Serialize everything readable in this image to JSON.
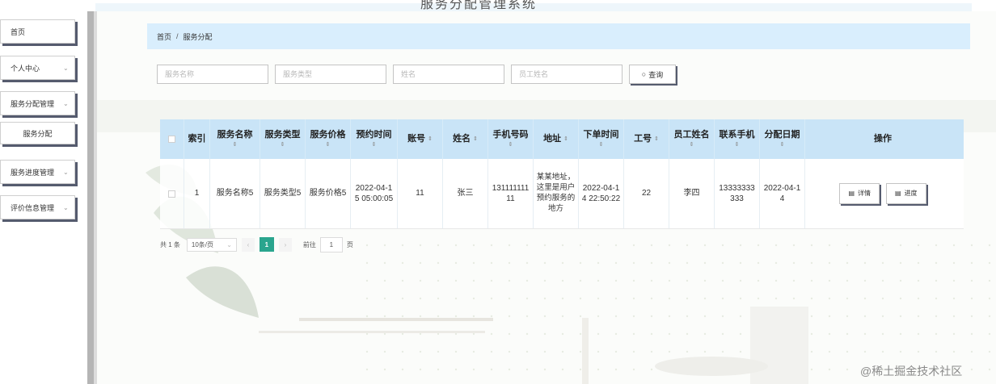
{
  "header": {
    "title": "服务分配管理系统"
  },
  "sidebar": {
    "items": [
      {
        "label": "首页",
        "chevron": ""
      },
      {
        "label": "个人中心",
        "chevron": "⌄"
      },
      {
        "label": "服务分配管理",
        "chevron": "⌄"
      },
      {
        "label": "服务分配",
        "chevron": ""
      },
      {
        "label": "服务进度管理",
        "chevron": "⌄"
      },
      {
        "label": "评价信息管理",
        "chevron": "⌄"
      }
    ]
  },
  "breadcrumb": {
    "home": "首页",
    "separator": "/",
    "current": "服务分配"
  },
  "search": {
    "fields": [
      {
        "placeholder": "服务名称"
      },
      {
        "placeholder": "服务类型"
      },
      {
        "placeholder": "姓名"
      },
      {
        "placeholder": "员工姓名"
      }
    ],
    "button_label": "查询",
    "button_icon": "search-icon"
  },
  "table": {
    "headers": [
      "索引",
      "服务名称",
      "服务类型",
      "服务价格",
      "预约时间",
      "账号",
      "姓名",
      "手机号码",
      "地址",
      "下单时间",
      "工号",
      "员工姓名",
      "联系手机",
      "分配日期",
      "操作"
    ],
    "sort_glyph": "⇕",
    "rows": [
      {
        "index": "1",
        "service_name": "服务名称5",
        "service_type": "服务类型5",
        "service_price": "服务价格5",
        "appointment_time": "2022-04-15 05:00:05",
        "account": "11",
        "name": "张三",
        "phone": "13111111111",
        "address": "某某地址，这里是用户预约服务的地方",
        "order_time": "2022-04-14 22:50:22",
        "employee_id": "22",
        "employee_name": "李四",
        "contact_phone": "13333333333",
        "assign_date": "2022-04-14",
        "actions": {
          "detail": "详情",
          "progress": "进度"
        }
      }
    ]
  },
  "pagination": {
    "total_text": "共 1 条",
    "page_size": "10条/页",
    "prev": "‹",
    "current_page": "1",
    "next": "›",
    "goto_label": "前往",
    "goto_value": "1",
    "page_suffix": "页"
  },
  "watermark": "@稀土掘金技术社区",
  "colors": {
    "breadcrumb_bg": "#d9eefd",
    "table_header_bg": "#c9e4f7",
    "pager_active": "#2aa58e",
    "button_shadow": "#555b6e"
  }
}
